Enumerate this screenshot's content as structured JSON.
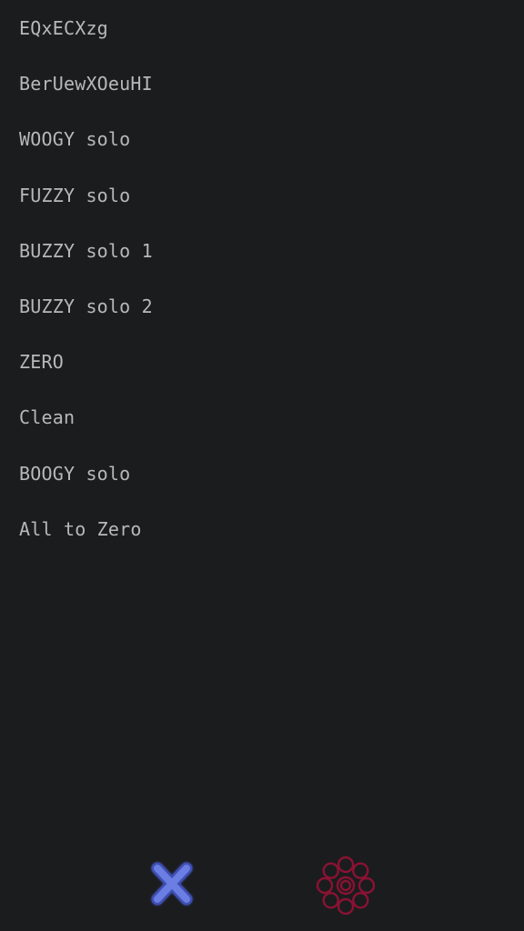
{
  "presets": [
    {
      "label": "EQxECXzg"
    },
    {
      "label": "BerUewXOeuHI"
    },
    {
      "label": "WOOGY solo"
    },
    {
      "label": "FUZZY solo"
    },
    {
      "label": "BUZZY solo 1"
    },
    {
      "label": "BUZZY solo 2"
    },
    {
      "label": "ZERO"
    },
    {
      "label": "Clean"
    },
    {
      "label": "BOOGY solo"
    },
    {
      "label": "All to Zero"
    }
  ],
  "bottom_bar": {
    "left_icon": "x-logo-icon",
    "right_icon": "flower-logo-icon",
    "left_icon_color": "#5b6fd6",
    "right_icon_color": "#8a1233"
  },
  "colors": {
    "background": "#1b1c1e",
    "text": "#b8b8b8"
  }
}
